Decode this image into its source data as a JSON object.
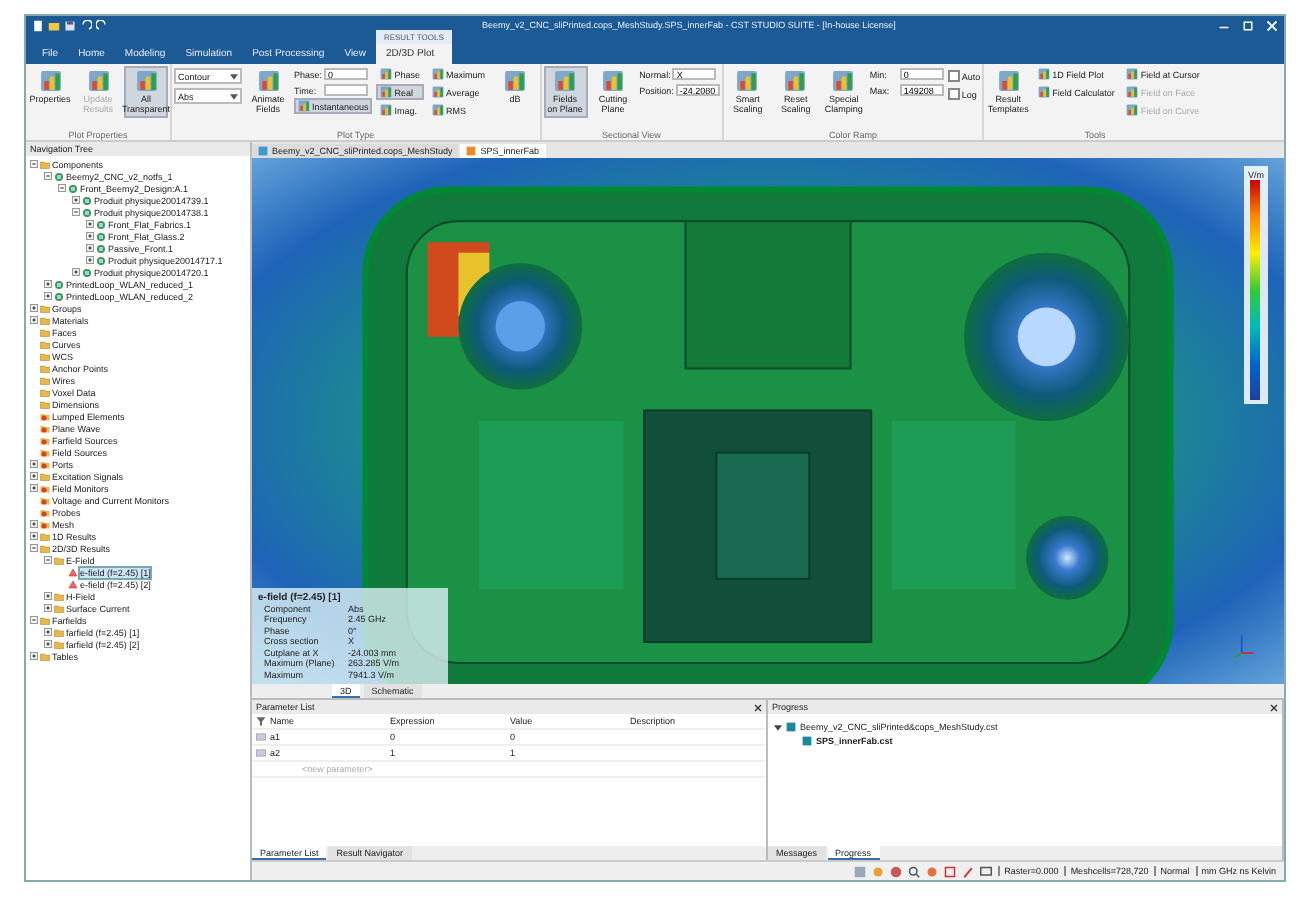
{
  "window": {
    "title": "Beemy_v2_CNC_sliPrinted.cops_MeshStudy.SPS_innerFab - CST STUDIO SUITE - [In-house License]"
  },
  "ribbon_tabs": [
    {
      "label": "File",
      "selected": false
    },
    {
      "label": "Home",
      "selected": false
    },
    {
      "label": "Modeling",
      "selected": false
    },
    {
      "label": "Simulation",
      "selected": false
    },
    {
      "label": "Post Processing",
      "selected": false
    },
    {
      "label": "View",
      "selected": false
    },
    {
      "label": "2D/3D Plot",
      "context": "RESULT TOOLS",
      "selected": true
    }
  ],
  "ribbon_groups": [
    {
      "label": "Plot Properties",
      "columns": [
        [
          {
            "kind": "big",
            "label": "Properties",
            "disabled": false,
            "selected": false
          }
        ],
        [
          {
            "kind": "big",
            "label": "Update Results",
            "disabled": true,
            "selected": false
          }
        ],
        [
          {
            "kind": "big",
            "label": "All Transparent",
            "disabled": false,
            "selected": true
          }
        ]
      ]
    },
    {
      "label": "Plot Type",
      "columns": [
        [
          {
            "kind": "dropdown",
            "value": "Contour"
          },
          {
            "kind": "dropdown",
            "value": "Abs"
          }
        ],
        [
          {
            "kind": "big",
            "label": "Animate Fields",
            "disabled": false,
            "selected": false
          }
        ],
        [
          {
            "kind": "field",
            "label": "Phase:",
            "value": "0"
          },
          {
            "kind": "field",
            "label": "Time:"
          },
          {
            "kind": "small",
            "label": "Instantaneous",
            "disabled": false,
            "selected": true
          }
        ],
        [
          {
            "kind": "small",
            "label": "Phase",
            "disabled": false,
            "selected": false
          },
          {
            "kind": "small",
            "label": "Real",
            "disabled": false,
            "selected": true
          },
          {
            "kind": "small",
            "label": "Imag.",
            "disabled": false,
            "selected": false
          }
        ],
        [
          {
            "kind": "small",
            "label": "Maximum",
            "disabled": false,
            "selected": false
          },
          {
            "kind": "small",
            "label": "Average",
            "disabled": false,
            "selected": false
          },
          {
            "kind": "small",
            "label": "RMS",
            "disabled": false,
            "selected": false
          }
        ],
        [
          {
            "kind": "big",
            "label": "dB",
            "disabled": false,
            "selected": false
          }
        ]
      ]
    },
    {
      "label": "Sectional View",
      "columns": [
        [
          {
            "kind": "big",
            "label": "Fields on Plane",
            "disabled": false,
            "selected": true
          }
        ],
        [
          {
            "kind": "big",
            "label": "Cutting Plane",
            "disabled": false,
            "selected": false
          }
        ],
        [
          {
            "kind": "field",
            "label": "Normal:",
            "value": "X"
          },
          {
            "kind": "field",
            "label": "Position:",
            "value": "-24.2080"
          }
        ]
      ]
    },
    {
      "label": "Color Ramp",
      "columns": [
        [
          {
            "kind": "big",
            "label": "Smart Scaling",
            "disabled": false,
            "selected": false
          }
        ],
        [
          {
            "kind": "big",
            "label": "Reset Scaling",
            "disabled": false,
            "selected": false
          }
        ],
        [
          {
            "kind": "big",
            "label": "Special Clamping",
            "disabled": false,
            "selected": false
          }
        ],
        [
          {
            "kind": "field",
            "label": "Min:",
            "value": "0"
          },
          {
            "kind": "field",
            "label": "Max:",
            "value": "149208"
          }
        ],
        [
          {
            "kind": "check",
            "label": "Auto",
            "checked": false
          },
          {
            "kind": "check",
            "label": "Log",
            "checked": false
          }
        ]
      ]
    },
    {
      "label": "Tools",
      "columns": [
        [
          {
            "kind": "big",
            "label": "Result Templates",
            "disabled": false,
            "selected": false
          }
        ],
        [
          {
            "kind": "small",
            "label": "1D Field Plot",
            "disabled": false,
            "selected": false
          },
          {
            "kind": "small",
            "label": "Field Calculator",
            "disabled": false,
            "selected": false
          }
        ],
        [
          {
            "kind": "small",
            "label": "Field at Cursor",
            "disabled": false,
            "selected": false
          },
          {
            "kind": "small",
            "label": "Field on Face",
            "disabled": true,
            "selected": false
          },
          {
            "kind": "small",
            "label": "Field on Curve",
            "disabled": true,
            "selected": false
          }
        ]
      ]
    }
  ],
  "navigation_tree": {
    "title": "Navigation Tree",
    "items": [
      {
        "label": "Components",
        "kind": "folder",
        "expanded": true,
        "selected": false,
        "children": [
          {
            "label": "Beemy2_CNC_v2_notfs_1",
            "kind": "part",
            "expanded": true,
            "selected": false,
            "children": [
              {
                "label": "Front_Beemy2_Design:A.1",
                "kind": "part",
                "expanded": true,
                "selected": false,
                "children": [
                  {
                    "label": "Produit physique20014739.1",
                    "kind": "part",
                    "expanded": false,
                    "selected": false
                  },
                  {
                    "label": "Produit physique20014738.1",
                    "kind": "part",
                    "expanded": true,
                    "selected": false,
                    "children": [
                      {
                        "label": "Front_Flat_Fabrics.1",
                        "kind": "part",
                        "expanded": false,
                        "selected": false
                      },
                      {
                        "label": "Front_Flat_Glass.2",
                        "kind": "part",
                        "expanded": false,
                        "selected": false
                      },
                      {
                        "label": "Passive_Front.1",
                        "kind": "part",
                        "expanded": false,
                        "selected": false
                      },
                      {
                        "label": "Produit physique20014717.1",
                        "kind": "part",
                        "expanded": false,
                        "selected": false
                      }
                    ]
                  },
                  {
                    "label": "Produit physique20014720.1",
                    "kind": "part",
                    "expanded": false,
                    "selected": false
                  }
                ]
              }
            ]
          },
          {
            "label": "PrintedLoop_WLAN_reduced_1",
            "kind": "part",
            "expanded": false,
            "selected": false
          },
          {
            "label": "PrintedLoop_WLAN_reduced_2",
            "kind": "part",
            "expanded": false,
            "selected": false
          }
        ]
      },
      {
        "label": "Groups",
        "kind": "folder",
        "expanded": false,
        "selected": false
      },
      {
        "label": "Materials",
        "kind": "folder",
        "expanded": false,
        "selected": false
      },
      {
        "label": "Faces",
        "kind": "folder",
        "selected": false
      },
      {
        "label": "Curves",
        "kind": "folder",
        "selected": false
      },
      {
        "label": "WCS",
        "kind": "folder",
        "selected": false
      },
      {
        "label": "Anchor Points",
        "kind": "folder",
        "selected": false
      },
      {
        "label": "Wires",
        "kind": "folder",
        "selected": false
      },
      {
        "label": "Voxel Data",
        "kind": "folder",
        "selected": false
      },
      {
        "label": "Dimensions",
        "kind": "folder",
        "selected": false
      },
      {
        "label": "Lumped Elements",
        "kind": "source",
        "selected": false
      },
      {
        "label": "Plane Wave",
        "kind": "source",
        "selected": false
      },
      {
        "label": "Farfield Sources",
        "kind": "source",
        "selected": false
      },
      {
        "label": "Field Sources",
        "kind": "source",
        "selected": false
      },
      {
        "label": "Ports",
        "kind": "source",
        "expanded": false,
        "selected": false
      },
      {
        "label": "Excitation Signals",
        "kind": "folder",
        "expanded": false,
        "selected": false
      },
      {
        "label": "Field Monitors",
        "kind": "source",
        "expanded": false,
        "selected": false
      },
      {
        "label": "Voltage and Current Monitors",
        "kind": "source",
        "selected": false
      },
      {
        "label": "Probes",
        "kind": "source",
        "selected": false
      },
      {
        "label": "Mesh",
        "kind": "source",
        "expanded": false,
        "selected": false
      },
      {
        "label": "1D Results",
        "kind": "folder",
        "expanded": false,
        "selected": false
      },
      {
        "label": "2D/3D Results",
        "kind": "folder",
        "expanded": true,
        "selected": false,
        "children": [
          {
            "label": "E-Field",
            "kind": "folder",
            "expanded": true,
            "selected": false,
            "children": [
              {
                "label": "e-field (f=2.45) [1]",
                "kind": "result",
                "selected": true
              },
              {
                "label": "e-field (f=2.45) [2]",
                "kind": "result",
                "selected": false
              }
            ]
          },
          {
            "label": "H-Field",
            "kind": "folder",
            "expanded": false,
            "selected": false
          },
          {
            "label": "Surface Current",
            "kind": "folder",
            "expanded": false,
            "selected": false
          }
        ]
      },
      {
        "label": "Farfields",
        "kind": "folder",
        "expanded": true,
        "selected": false,
        "children": [
          {
            "label": "farfield (f=2.45) [1]",
            "kind": "folder",
            "expanded": false,
            "selected": false
          },
          {
            "label": "farfield (f=2.45) [2]",
            "kind": "folder",
            "expanded": false,
            "selected": false
          }
        ]
      },
      {
        "label": "Tables",
        "kind": "folder",
        "expanded": false,
        "selected": false
      }
    ]
  },
  "view": {
    "tabs": [
      {
        "label": "Beemy_v2_CNC_sliPrinted.cops_MeshStudy",
        "selected": false
      },
      {
        "label": "SPS_innerFab",
        "selected": true
      }
    ],
    "legend_unit": "V/m",
    "info": {
      "title": "e-field (f=2.45) [1]",
      "rows": [
        [
          "Component",
          "Abs"
        ],
        [
          "Frequency",
          "2.45 GHz"
        ],
        [
          "Phase",
          "0°"
        ],
        [
          "Cross section",
          "X"
        ],
        [
          "Cutplane at X",
          "-24.003 mm"
        ],
        [
          "Maximum (Plane)",
          "263.285 V/m"
        ],
        [
          "Maximum",
          "7941.3 V/m"
        ]
      ]
    },
    "bottom_tabs": [
      {
        "label": "3D",
        "selected": true
      },
      {
        "label": "Schematic",
        "selected": false
      }
    ]
  },
  "parameter_list": {
    "title": "Parameter List",
    "columns": [
      "Name",
      "Expression",
      "Value",
      "Description"
    ],
    "rows": [
      [
        "a1",
        "0",
        "0",
        ""
      ],
      [
        "a2",
        "1",
        "1",
        ""
      ]
    ],
    "new_row": "<new parameter>",
    "tabs": [
      {
        "label": "Parameter List",
        "selected": true
      },
      {
        "label": "Result Navigator",
        "selected": false
      }
    ]
  },
  "progress": {
    "title": "Progress",
    "items": [
      {
        "label": "Beemy_v2_CNC_sliPrinted&cops_MeshStudy.cst",
        "expanded": true,
        "children": [
          {
            "label": "SPS_innerFab.cst"
          }
        ]
      }
    ],
    "tabs": [
      {
        "label": "Messages",
        "selected": false
      },
      {
        "label": "Progress",
        "selected": true
      }
    ]
  },
  "status_bar": [
    "Raster=0.000",
    "Meshcells=728,720",
    "Normal",
    "mm GHz ns Kelvin"
  ]
}
